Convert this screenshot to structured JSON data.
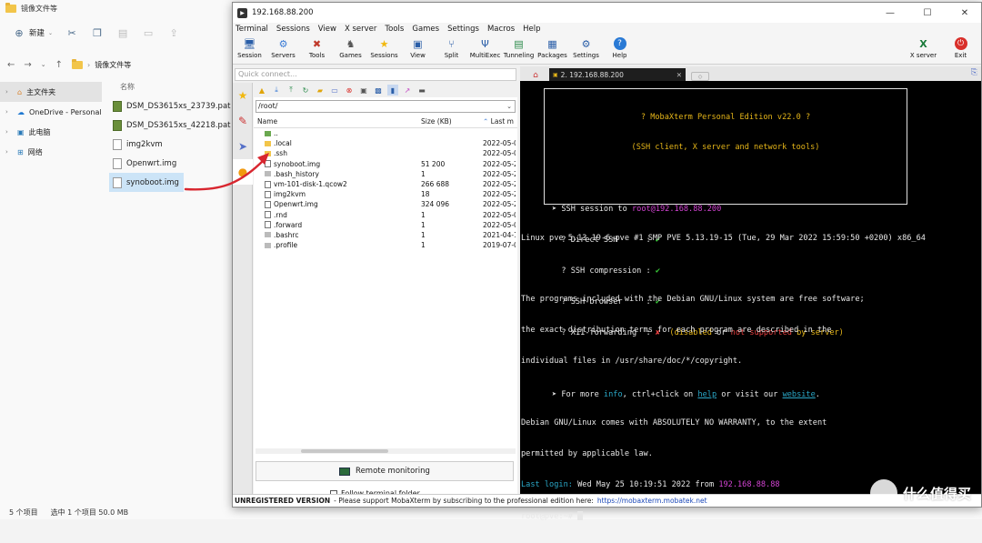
{
  "explorer": {
    "title": "镜像文件等",
    "toolbar": {
      "new_label": "新建"
    },
    "breadcrumb": "镜像文件等",
    "nav": [
      {
        "label": "主文件夹",
        "selected": true
      },
      {
        "label": "OneDrive - Personal",
        "selected": false
      },
      {
        "label": "此电脑",
        "selected": false
      },
      {
        "label": "网络",
        "selected": false
      }
    ],
    "column_name": "名称",
    "files": [
      {
        "name": "DSM_DS3615xs_23739.pat",
        "icon": "pat-file-icon",
        "selected": false
      },
      {
        "name": "DSM_DS3615xs_42218.pat",
        "icon": "pat-file-icon",
        "selected": false
      },
      {
        "name": "img2kvm",
        "icon": "file-icon",
        "selected": false
      },
      {
        "name": "Openwrt.img",
        "icon": "file-icon",
        "selected": false
      },
      {
        "name": "synoboot.img",
        "icon": "file-icon",
        "selected": true
      }
    ],
    "status": {
      "count": "5 个项目",
      "selected": "选中 1 个项目  50.0 MB"
    }
  },
  "moba": {
    "title": "192.168.88.200",
    "menu": [
      "Terminal",
      "Sessions",
      "View",
      "X server",
      "Tools",
      "Games",
      "Settings",
      "Macros",
      "Help"
    ],
    "tools": [
      {
        "label": "Session",
        "icon": "session-icon"
      },
      {
        "label": "Servers",
        "icon": "servers-icon"
      },
      {
        "label": "Tools",
        "icon": "tools-icon"
      },
      {
        "label": "Games",
        "icon": "games-icon"
      },
      {
        "label": "Sessions",
        "icon": "star-icon"
      },
      {
        "label": "View",
        "icon": "view-icon"
      },
      {
        "label": "Split",
        "icon": "split-icon"
      },
      {
        "label": "MultiExec",
        "icon": "multiexec-icon"
      },
      {
        "label": "Tunneling",
        "icon": "tunneling-icon"
      },
      {
        "label": "Packages",
        "icon": "packages-icon"
      },
      {
        "label": "Settings",
        "icon": "settings-icon"
      },
      {
        "label": "Help",
        "icon": "help-icon"
      }
    ],
    "tools_right": [
      {
        "label": "X server",
        "icon": "xserver-icon"
      },
      {
        "label": "Exit",
        "icon": "exit-icon"
      }
    ],
    "quick_connect_placeholder": "Quick connect...",
    "sftp": {
      "path": "/root/",
      "headers": {
        "name": "Name",
        "size": "Size (KB)",
        "modified": "Last m"
      },
      "rows": [
        {
          "name": "..",
          "size": "",
          "date": "",
          "type": "up"
        },
        {
          "name": ".local",
          "size": "",
          "date": "2022-05-0",
          "type": "folder"
        },
        {
          "name": ".ssh",
          "size": "",
          "date": "2022-05-0",
          "type": "folder"
        },
        {
          "name": "synoboot.img",
          "size": "51 200",
          "date": "2022-05-2",
          "type": "doc"
        },
        {
          "name": ".bash_history",
          "size": "1",
          "date": "2022-05-2",
          "type": "file"
        },
        {
          "name": "vm-101-disk-1.qcow2",
          "size": "266 688",
          "date": "2022-05-2",
          "type": "doc"
        },
        {
          "name": "img2kvm",
          "size": "18",
          "date": "2022-05-2",
          "type": "doc"
        },
        {
          "name": "Openwrt.img",
          "size": "324 096",
          "date": "2022-05-2",
          "type": "doc"
        },
        {
          "name": ".rnd",
          "size": "1",
          "date": "2022-05-0",
          "type": "doc"
        },
        {
          "name": ".forward",
          "size": "1",
          "date": "2022-05-0",
          "type": "doc"
        },
        {
          "name": ".bashrc",
          "size": "1",
          "date": "2021-04-1",
          "type": "file"
        },
        {
          "name": ".profile",
          "size": "1",
          "date": "2019-07-0",
          "type": "file"
        }
      ],
      "remote_monitoring": "Remote monitoring",
      "follow_terminal": "Follow terminal folder"
    },
    "tab": {
      "label": "2. 192.168.88.200"
    },
    "terminal": {
      "banner_title": "? MobaXterm Personal Edition v22.0 ?",
      "banner_subtitle": "(SSH client, X server and network tools)",
      "ssh_session_prefix": "➤ SSH session to ",
      "ssh_target": "root@192.168.88.200",
      "features": [
        {
          "label": "  ? Direct SSH      :",
          "mark": "✔",
          "status": "ok"
        },
        {
          "label": "  ? SSH compression :",
          "mark": "✔",
          "status": "ok"
        },
        {
          "label": "  ? SSH-browser     :",
          "mark": "✔",
          "status": "ok"
        },
        {
          "label": "  ? X11-forwarding  :",
          "mark": "✘",
          "status": "fail"
        }
      ],
      "x11_note_1": "(disabled ",
      "x11_note_or": "or",
      "x11_note_2": " not supported",
      "x11_note_3": " by server)",
      "more_info_1": "➤ For more ",
      "more_info_link": "info",
      "more_info_2": ", ctrl+click on ",
      "more_info_help": "help",
      "more_info_3": " or visit our ",
      "more_info_site": "website",
      "more_info_4": ".",
      "uname": "Linux pve 5.13.19-6-pve #1 SMP PVE 5.13.19-15 (Tue, 29 Mar 2022 15:59:50 +0200) x86_64",
      "motd_1": "The programs included with the Debian GNU/Linux system are free software;",
      "motd_2": "the exact distribution terms for each program are described in the",
      "motd_3": "individual files in /usr/share/doc/*/copyright.",
      "warranty_1": "Debian GNU/Linux comes with ABSOLUTELY NO WARRANTY, to the extent",
      "warranty_2": "permitted by applicable law.",
      "last_login_label": "Last login:",
      "last_login_text": " Wed May 25 10:19:51 2022 from ",
      "last_login_ip": "192.168.88.88",
      "prompt": "root@pve:~# "
    },
    "status_bar": {
      "unregistered": "UNREGISTERED VERSION",
      "message": " -  Please support MobaXterm by subscribing to the professional edition here: ",
      "link": "https://mobaxterm.mobatek.net"
    }
  },
  "watermark": "什么值得买",
  "colors": {
    "arrow": "#d8262f",
    "terminal_yellow": "#e6b619",
    "terminal_magenta": "#d444d4"
  }
}
